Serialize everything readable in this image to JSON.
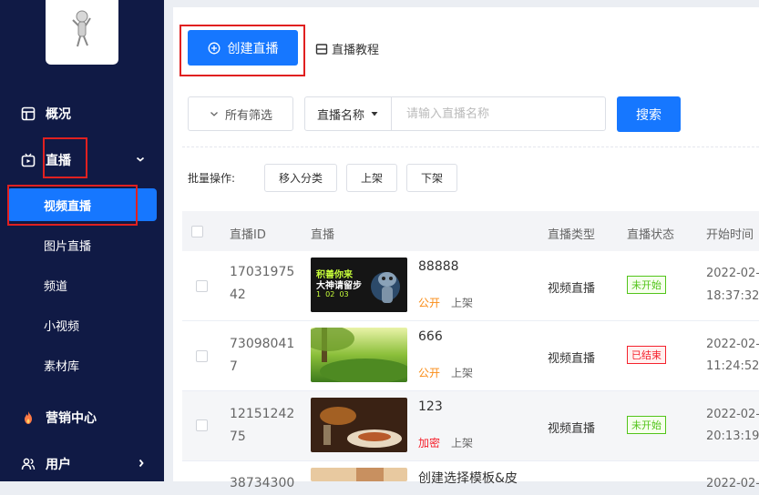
{
  "sidebar": {
    "nav": [
      {
        "label": "概况",
        "icon": "dashboard-icon"
      },
      {
        "label": "直播",
        "icon": "live-tv-icon"
      },
      {
        "label": "营销中心",
        "icon": "flame-icon"
      },
      {
        "label": "用户",
        "icon": "users-icon"
      }
    ],
    "sub": [
      "视频直播",
      "图片直播",
      "频道",
      "小视频",
      "素材库"
    ]
  },
  "header": {
    "create_label": "创建直播",
    "tutorial_label": "直播教程"
  },
  "filters": {
    "all_filters_label": "所有筛选",
    "search_field_label": "直播名称",
    "search_placeholder": "请输入直播名称",
    "search_button": "搜索"
  },
  "bulk": {
    "label": "批量操作:",
    "move_category": "移入分类",
    "shelf_on": "上架",
    "shelf_off": "下架"
  },
  "table": {
    "columns": [
      "直播ID",
      "直播",
      "直播类型",
      "直播状态",
      "开始时间"
    ],
    "rows": [
      {
        "id": "1703197542",
        "name": "88888",
        "visibility": "公开",
        "shelf": "上架",
        "type": "视频直播",
        "status": "未开始",
        "date": "2022-02-",
        "time": "18:37:32",
        "thumb_text1": "积善你来",
        "thumb_text2": "大神请留步",
        "thumb_text3": "1  02  03"
      },
      {
        "id": "730980417",
        "name": "666",
        "visibility": "公开",
        "shelf": "上架",
        "type": "视频直播",
        "status": "已结束",
        "date": "2022-02-",
        "time": "11:24:52"
      },
      {
        "id": "12151242 75",
        "name": "123",
        "visibility": "加密",
        "shelf": "上架",
        "type": "视频直播",
        "status": "未开始",
        "date": "2022-02-",
        "time": "20:13:19"
      },
      {
        "id": "38734300",
        "name": "创建选择模板&皮",
        "date": "2022-02-"
      }
    ]
  },
  "colors": {
    "sidebar_bg": "#101a45",
    "primary": "#1677ff",
    "highlight_box": "#e02020",
    "status_pending": "#52c41a",
    "status_ended": "#f5222d",
    "public": "#fa8c16",
    "encrypted": "#f5222d"
  }
}
